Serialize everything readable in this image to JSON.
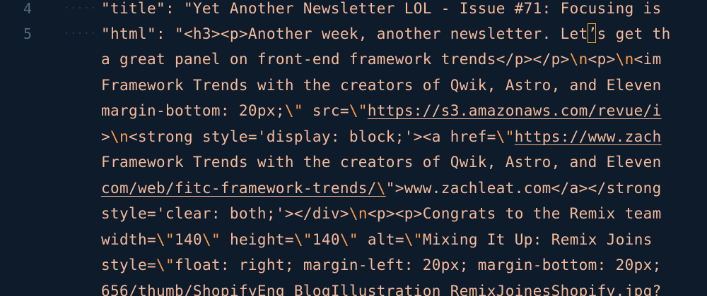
{
  "gutter": {
    "line_numbers": [
      "4",
      "5"
    ]
  },
  "colors": {
    "background": "#0d1b2a",
    "string": "#f4b99b",
    "escape": "#ff9c4d",
    "line_number": "#56697a",
    "cursor_border": "#e2a93b"
  },
  "code": {
    "l0": [
      "\"title\": \"Yet Another Newsletter LOL - Issue #71: Focusing is"
    ],
    "l1": [
      "\"html\": \"<h3><p>Another week, another newsletter. Let",
      "’",
      "s get th"
    ],
    "l2": [
      "a great panel on front-end framework trends</p></p>",
      "\\n",
      "<p>",
      "\\n",
      "<im"
    ],
    "l3": [
      "Framework Trends with the creators of Qwik, Astro, and Eleven"
    ],
    "l4": [
      "margin-bottom: 20px;",
      "\\\"",
      " src=",
      "\\\"",
      "https://s3.amazonaws.com/revue/i"
    ],
    "l5": [
      ">",
      "\\n",
      "<strong style='display: block;'><a href=",
      "\\\"",
      "https://www.zach"
    ],
    "l6": [
      "Framework Trends with the creators of Qwik, Astro, and Eleven"
    ],
    "l7": [
      "com/web/fitc-framework-trends/",
      "\\",
      "\"",
      ">www.zachleat.com</a></strong"
    ],
    "l8": [
      "style='clear: both;'></div>",
      "\\n",
      "<p><p>Congrats to the Remix team"
    ],
    "l9": [
      "width=",
      "\\\"",
      "140",
      "\\\"",
      " height=",
      "\\\"",
      "140",
      "\\\"",
      " alt=",
      "\\\"",
      "Mixing It Up: Remix Joins"
    ],
    "l10": [
      "style=",
      "\\\"",
      "float: right; margin-left: 20px; margin-bottom: 20px;"
    ],
    "l11": [
      "656/thumb/ShopifyEng_BlogIllustration_RemixJoinesShopify.jpg?"
    ]
  }
}
